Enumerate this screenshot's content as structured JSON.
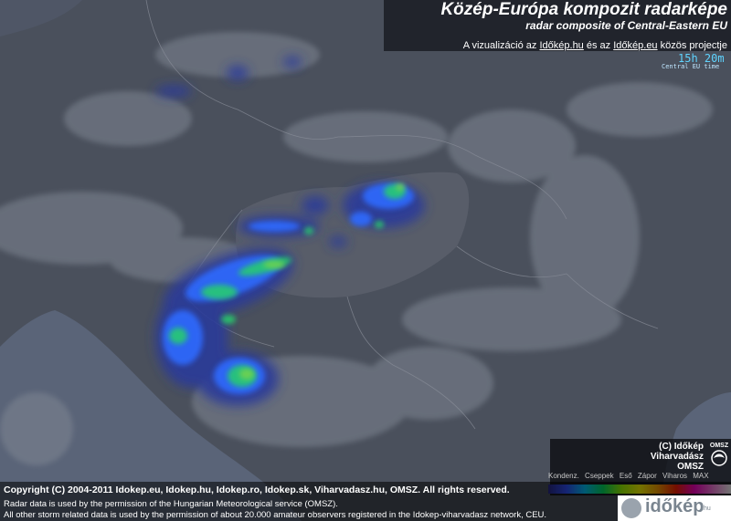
{
  "header": {
    "title": "Közép-Európa kompozit radarképe",
    "subtitle": "radar composite of Central-Eastern EU",
    "project_prefix": "A vizualizáció az",
    "link1": "Időkép.hu",
    "project_middle": "és az",
    "link2": "Időkép.eu",
    "project_suffix": "közös projectje"
  },
  "time": {
    "value": "15h 20m",
    "zone": "Central EU time"
  },
  "legend": {
    "brand_line1": "(C) Időkép",
    "brand_line2": "Viharvadász",
    "brand_line3": "OMSZ",
    "omsz_logo_label": "OMSZ",
    "labels": [
      "Kondenz.",
      "Cseppek",
      "Eső",
      "Zápor",
      "Viharos",
      "MAX"
    ],
    "scale_colors": [
      "#2a2a8a",
      "#3050ff",
      "#00c8ff",
      "#00e060",
      "#9bff00",
      "#ffff00",
      "#ffa000",
      "#ff2000",
      "#ff00c8",
      "#ffffff"
    ]
  },
  "footer": {
    "copyright": "Copyright (C) 2004-2011 Idokep.eu, Idokep.hu, Idokep.ro, Idokep.sk, Viharvadasz.hu, OMSZ. All rights reserved.",
    "permission1": "Radar data is used by the permission of the Hungarian Meteorological service (OMSZ).",
    "permission2": "All other storm related data is used by the permission of about 20.000 amateur observers registered in the Idokep-viharvadasz network, CEU.",
    "brand_logo": "időkép",
    "brand_logo_small": ".hu"
  },
  "map": {
    "background_color": "#4a505c",
    "sea_color": "#5a6478",
    "mountain_color": "#7f8693",
    "hungary_region_color": "#5a5f6b",
    "precip_colors": [
      "#2b3a9a",
      "#2f6bff",
      "#27d06a",
      "#7ad44a"
    ]
  }
}
